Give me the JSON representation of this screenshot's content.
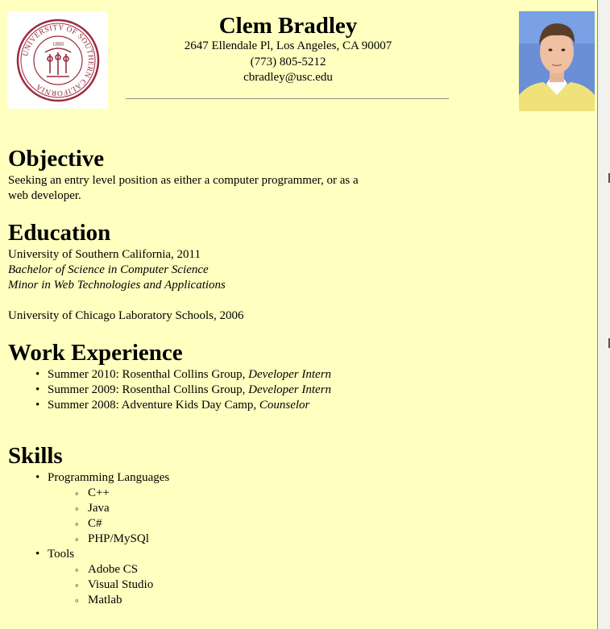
{
  "header": {
    "name": "Clem Bradley",
    "address": "2647 Ellendale Pl, Los Angeles, CA 90007",
    "phone": "(773) 805-5212",
    "email": "cbradley@usc.edu"
  },
  "logo": {
    "seal_text_top": "UNIVERSITY OF SOUTHERN CALIFORNIA",
    "seal_year": "1880"
  },
  "objective": {
    "heading": "Objective",
    "line1": "Seeking an entry level position as either a computer programmer, or as a",
    "line2": "web developer."
  },
  "education": {
    "heading": "Education",
    "school1": "University of Southern California, 2011",
    "degree": "Bachelor of Science in Computer Science",
    "minor": "Minor in Web Technologies and Applications",
    "school2": "University of Chicago Laboratory Schools, 2006"
  },
  "work": {
    "heading": "Work Experience",
    "items": [
      {
        "text": "Summer 2010: Rosenthal Collins Group, ",
        "role": "Developer Intern"
      },
      {
        "text": "Summer 2009: Rosenthal Collins Group, ",
        "role": "Developer Intern"
      },
      {
        "text": "Summer 2008: Adventure Kids Day Camp, ",
        "role": "Counselor"
      }
    ]
  },
  "skills": {
    "heading": "Skills",
    "groups": [
      {
        "label": "Programming Languages",
        "items": [
          "C++",
          "Java",
          "C#",
          "PHP/MySQl"
        ]
      },
      {
        "label": "Tools",
        "items": [
          "Adobe CS",
          "Visual Studio",
          "Matlab"
        ]
      }
    ]
  },
  "colors": {
    "background": "#ffffc0",
    "seal": "#9b2c3c"
  }
}
